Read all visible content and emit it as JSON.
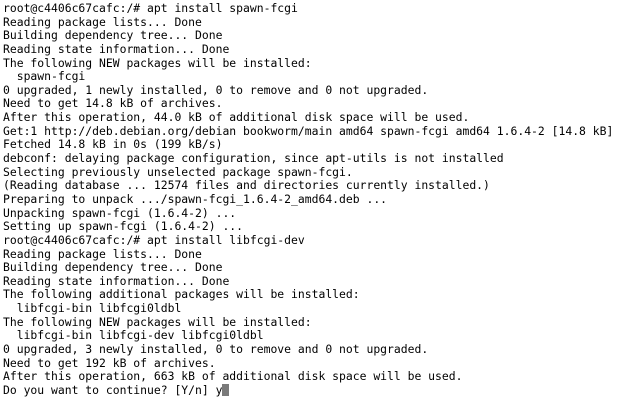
{
  "terminal": {
    "lines": [
      "root@c4406c67cafc:/# apt install spawn-fcgi",
      "Reading package lists... Done",
      "Building dependency tree... Done",
      "Reading state information... Done",
      "The following NEW packages will be installed:",
      "  spawn-fcgi",
      "0 upgraded, 1 newly installed, 0 to remove and 0 not upgraded.",
      "Need to get 14.8 kB of archives.",
      "After this operation, 44.0 kB of additional disk space will be used.",
      "Get:1 http://deb.debian.org/debian bookworm/main amd64 spawn-fcgi amd64 1.6.4-2 [14.8 kB]",
      "Fetched 14.8 kB in 0s (199 kB/s)",
      "debconf: delaying package configuration, since apt-utils is not installed",
      "Selecting previously unselected package spawn-fcgi.",
      "(Reading database ... 12574 files and directories currently installed.)",
      "Preparing to unpack .../spawn-fcgi_1.6.4-2_amd64.deb ...",
      "Unpacking spawn-fcgi (1.6.4-2) ...",
      "Setting up spawn-fcgi (1.6.4-2) ...",
      "root@c4406c67cafc:/# apt install libfcgi-dev",
      "Reading package lists... Done",
      "Building dependency tree... Done",
      "Reading state information... Done",
      "The following additional packages will be installed:",
      "  libfcgi-bin libfcgi0ldbl",
      "The following NEW packages will be installed:",
      "  libfcgi-bin libfcgi-dev libfcgi0ldbl",
      "0 upgraded, 3 newly installed, 0 to remove and 0 not upgraded.",
      "Need to get 192 kB of archives.",
      "After this operation, 663 kB of additional disk space will be used."
    ],
    "prompt": "Do you want to continue? [Y/n] ",
    "input": "y"
  }
}
